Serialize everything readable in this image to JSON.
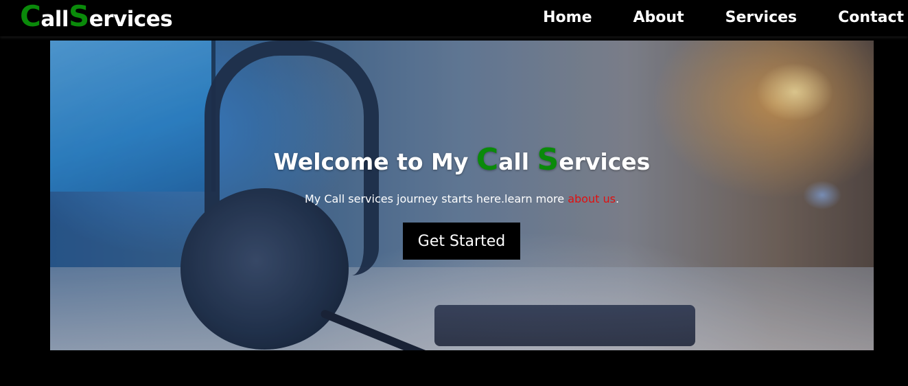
{
  "logo": {
    "c": "C",
    "all": "all",
    "s": "S",
    "ervices": "ervices"
  },
  "nav": {
    "items": [
      {
        "label": "Home"
      },
      {
        "label": "About"
      },
      {
        "label": "Services"
      },
      {
        "label": "Contact"
      }
    ]
  },
  "hero": {
    "title_prefix": "Welcome to My ",
    "title_c": "C",
    "title_all": "all ",
    "title_s": "S",
    "title_ervices": "ervices",
    "subtitle_text": "My Call services journey starts here.learn more ",
    "subtitle_link": "about us",
    "subtitle_end": ".",
    "cta_label": "Get Started"
  },
  "colors": {
    "accent_green": "#0a8a0a",
    "link_red": "#e01010",
    "background": "#000000"
  }
}
